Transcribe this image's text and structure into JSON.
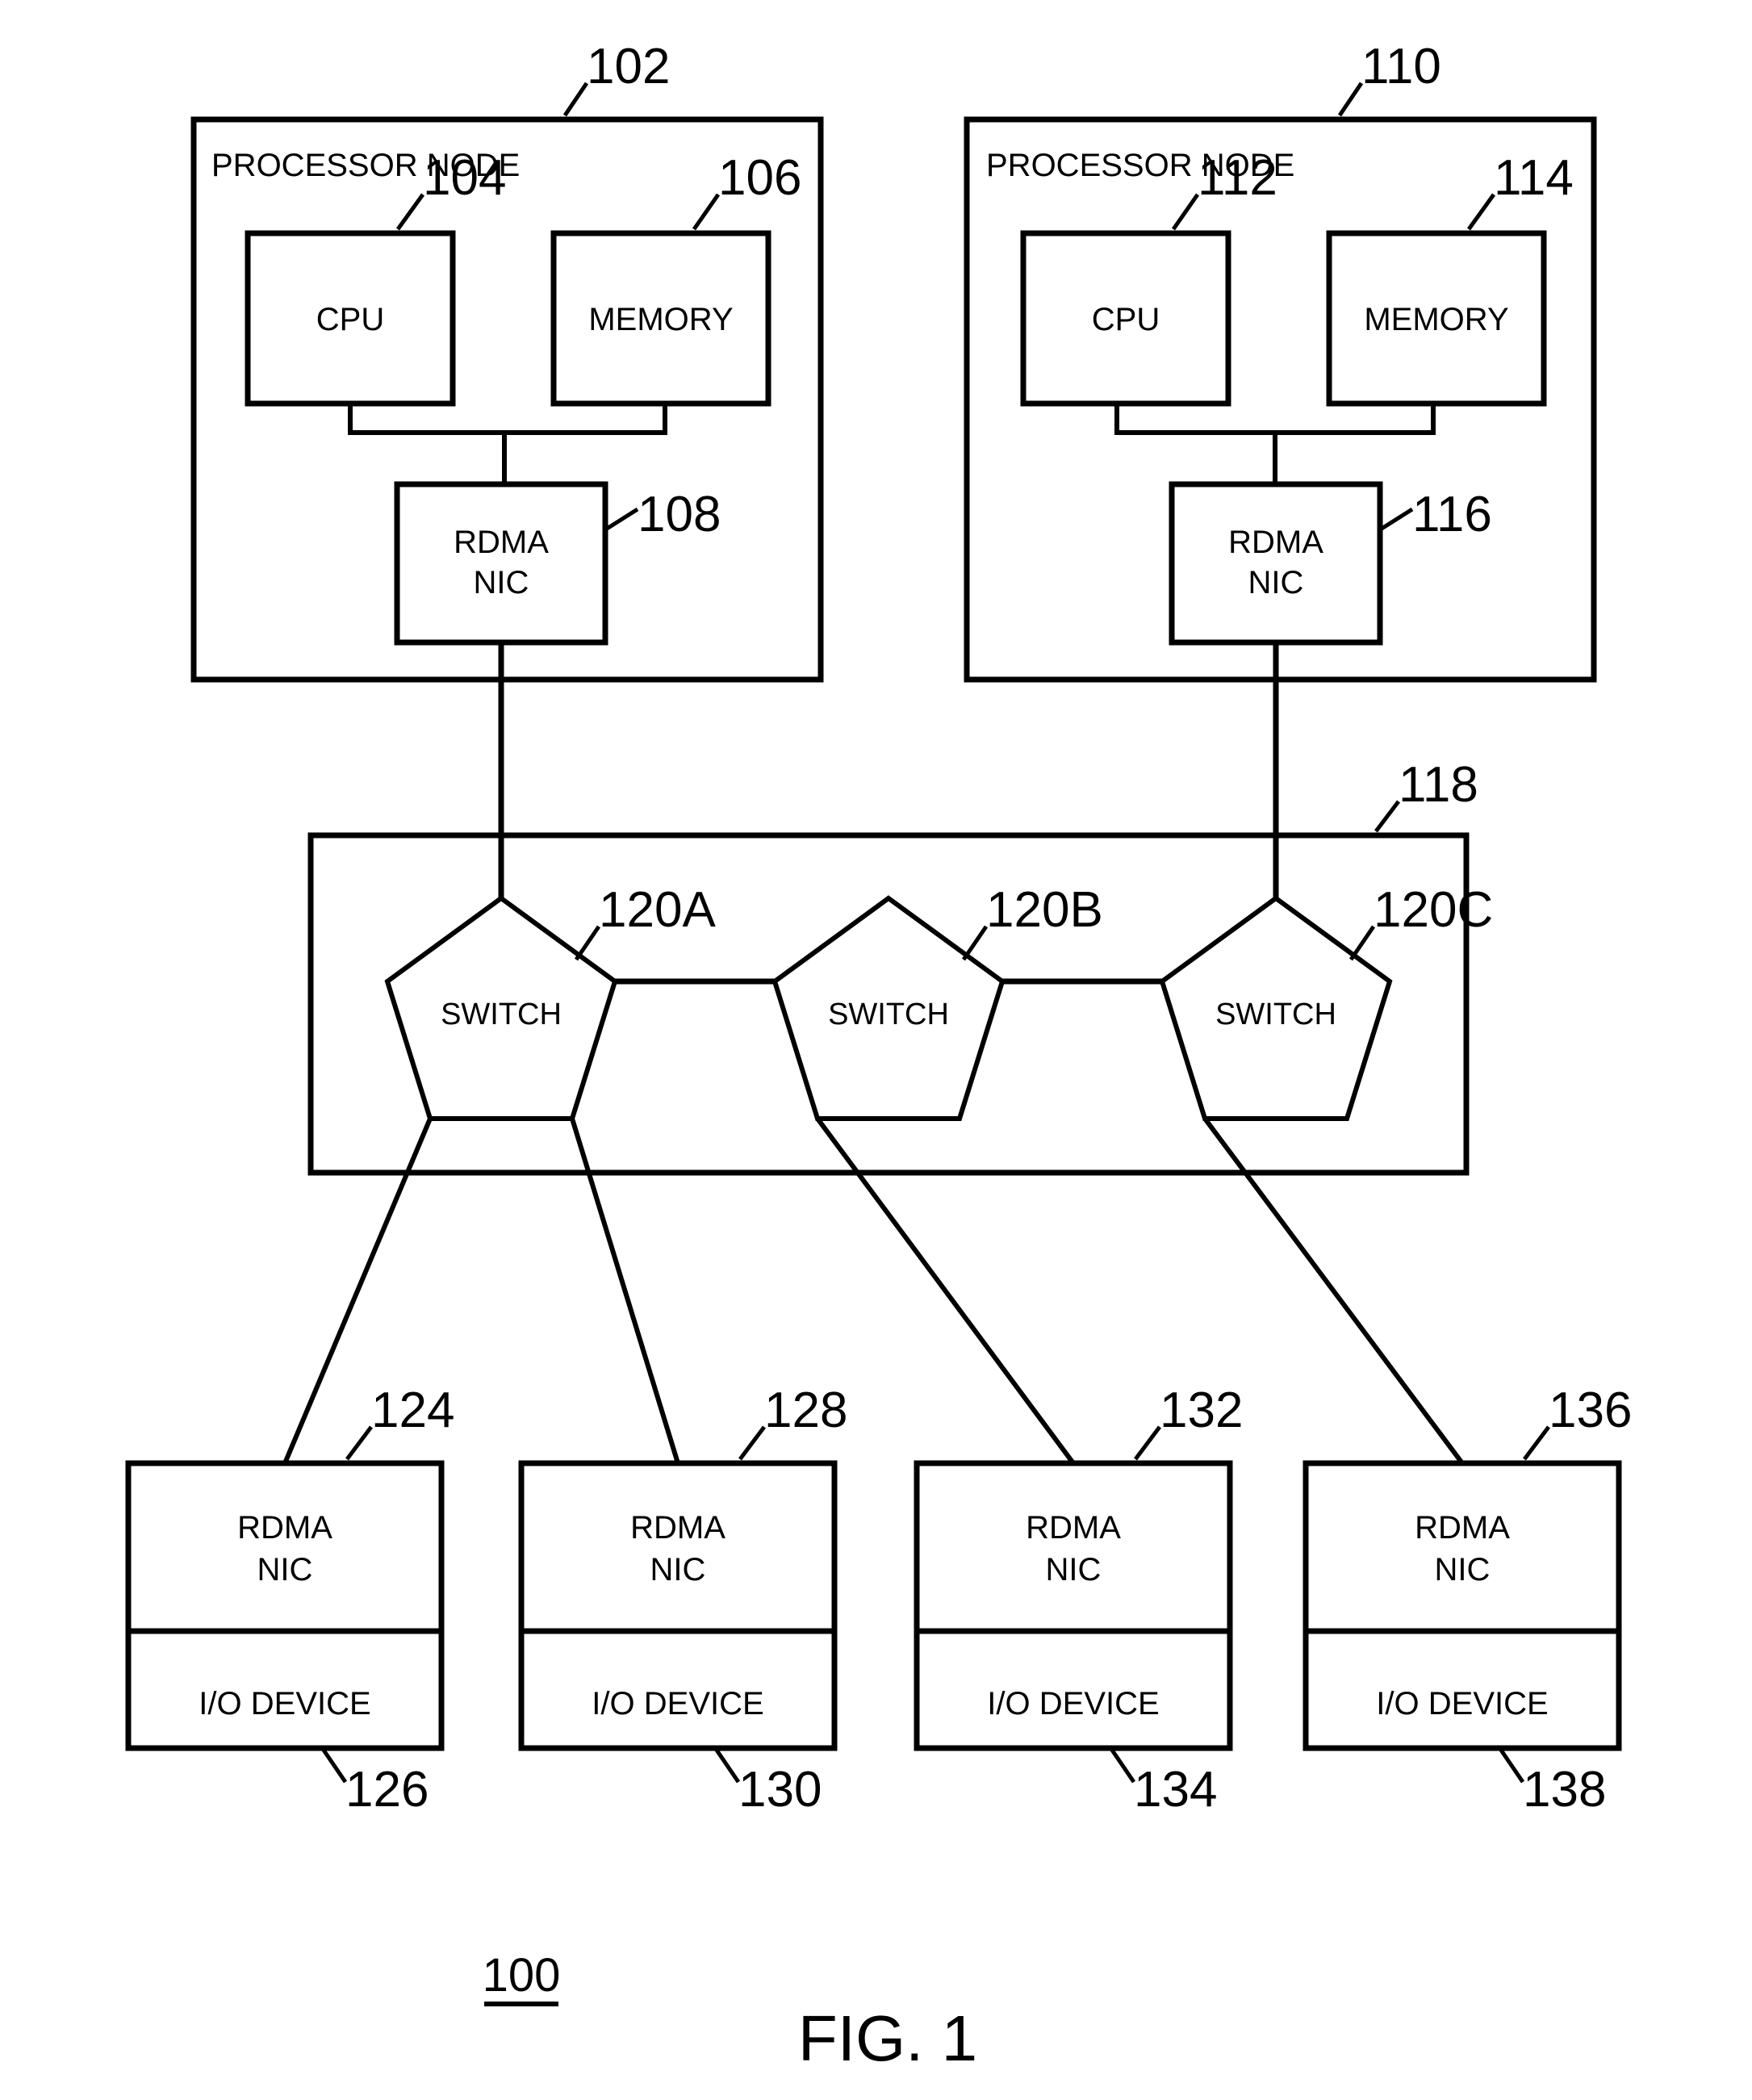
{
  "figure": {
    "title": "FIG. 1",
    "system_ref": "100",
    "domain_label": "rdma-network-block-diagram"
  },
  "processor_nodes": [
    {
      "id": "node-left",
      "ref": "102",
      "title": "PROCESSOR NODE",
      "cpu": {
        "label": "CPU",
        "ref": "104"
      },
      "memory": {
        "label": "MEMORY",
        "ref": "106"
      },
      "nic": {
        "label_line1": "RDMA",
        "label_line2": "NIC",
        "ref": "108"
      }
    },
    {
      "id": "node-right",
      "ref": "110",
      "title": "PROCESSOR NODE",
      "cpu": {
        "label": "CPU",
        "ref": "112"
      },
      "memory": {
        "label": "MEMORY",
        "ref": "114"
      },
      "nic": {
        "label_line1": "RDMA",
        "label_line2": "NIC",
        "ref": "116"
      }
    }
  ],
  "fabric": {
    "ref": "118",
    "switches": [
      {
        "label": "SWITCH",
        "ref": "120A"
      },
      {
        "label": "SWITCH",
        "ref": "120B"
      },
      {
        "label": "SWITCH",
        "ref": "120C"
      }
    ]
  },
  "io_units": [
    {
      "nic": {
        "label_line1": "RDMA",
        "label_line2": "NIC",
        "ref": "124"
      },
      "device": {
        "label": "I/O DEVICE",
        "ref": "126"
      }
    },
    {
      "nic": {
        "label_line1": "RDMA",
        "label_line2": "NIC",
        "ref": "128"
      },
      "device": {
        "label": "I/O DEVICE",
        "ref": "130"
      }
    },
    {
      "nic": {
        "label_line1": "RDMA",
        "label_line2": "NIC",
        "ref": "132"
      },
      "device": {
        "label": "I/O DEVICE",
        "ref": "134"
      }
    },
    {
      "nic": {
        "label_line1": "RDMA",
        "label_line2": "NIC",
        "ref": "136"
      },
      "device": {
        "label": "I/O DEVICE",
        "ref": "138"
      }
    }
  ],
  "colors": {
    "ink": "#000000",
    "paper": "#ffffff"
  }
}
